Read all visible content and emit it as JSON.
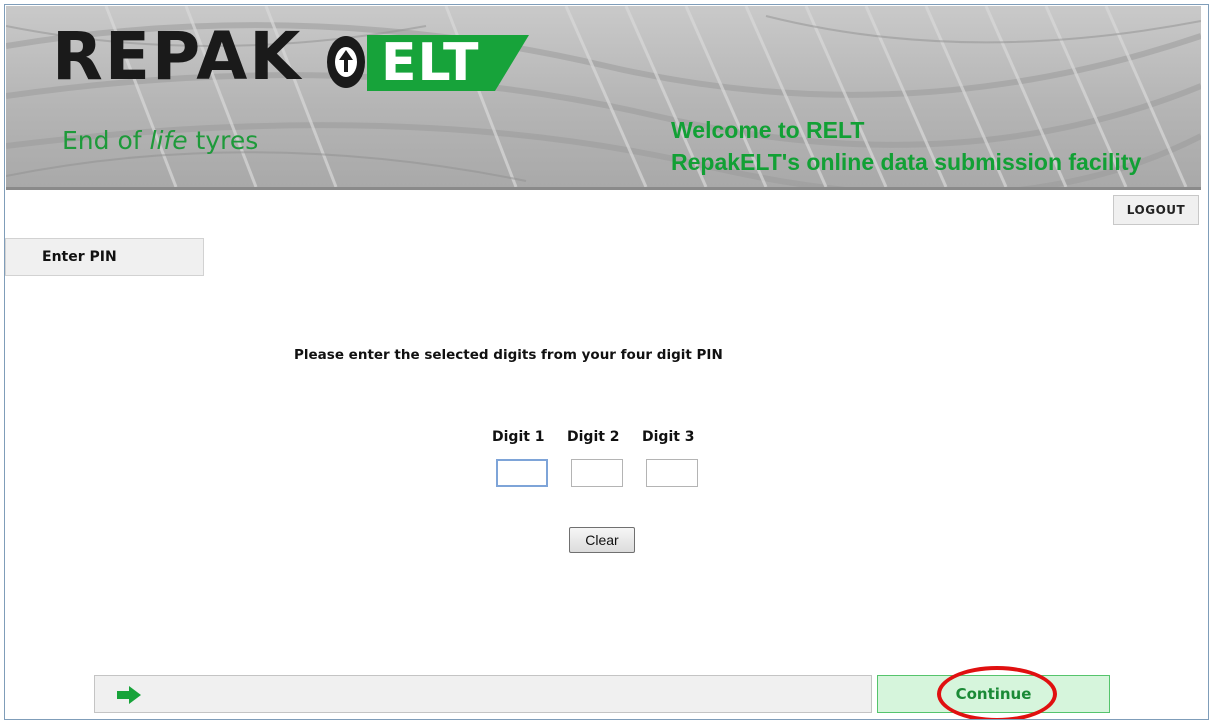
{
  "header": {
    "logo_word": "REPAK",
    "logo_suffix": "ELT",
    "tagline_pre": "End of ",
    "tagline_em": "life",
    "tagline_post": " tyres",
    "welcome_line1": "Welcome to RELT",
    "welcome_line2": "RepakELT's online data submission facility"
  },
  "toolbar": {
    "logout_label": "LOGOUT"
  },
  "tab": {
    "label": "Enter PIN"
  },
  "main": {
    "instruction": "Please enter the selected digits from your four digit PIN",
    "digits": [
      {
        "label": "Digit 1",
        "value": ""
      },
      {
        "label": "Digit 2",
        "value": ""
      },
      {
        "label": "Digit 3",
        "value": ""
      }
    ],
    "clear_label": "Clear"
  },
  "footer": {
    "continue_label": "Continue",
    "arrow_icon": "right-arrow-icon"
  },
  "colors": {
    "brand_green": "#12a035",
    "continue_bg": "#d6f5dc",
    "annotation_red": "#e01010"
  }
}
